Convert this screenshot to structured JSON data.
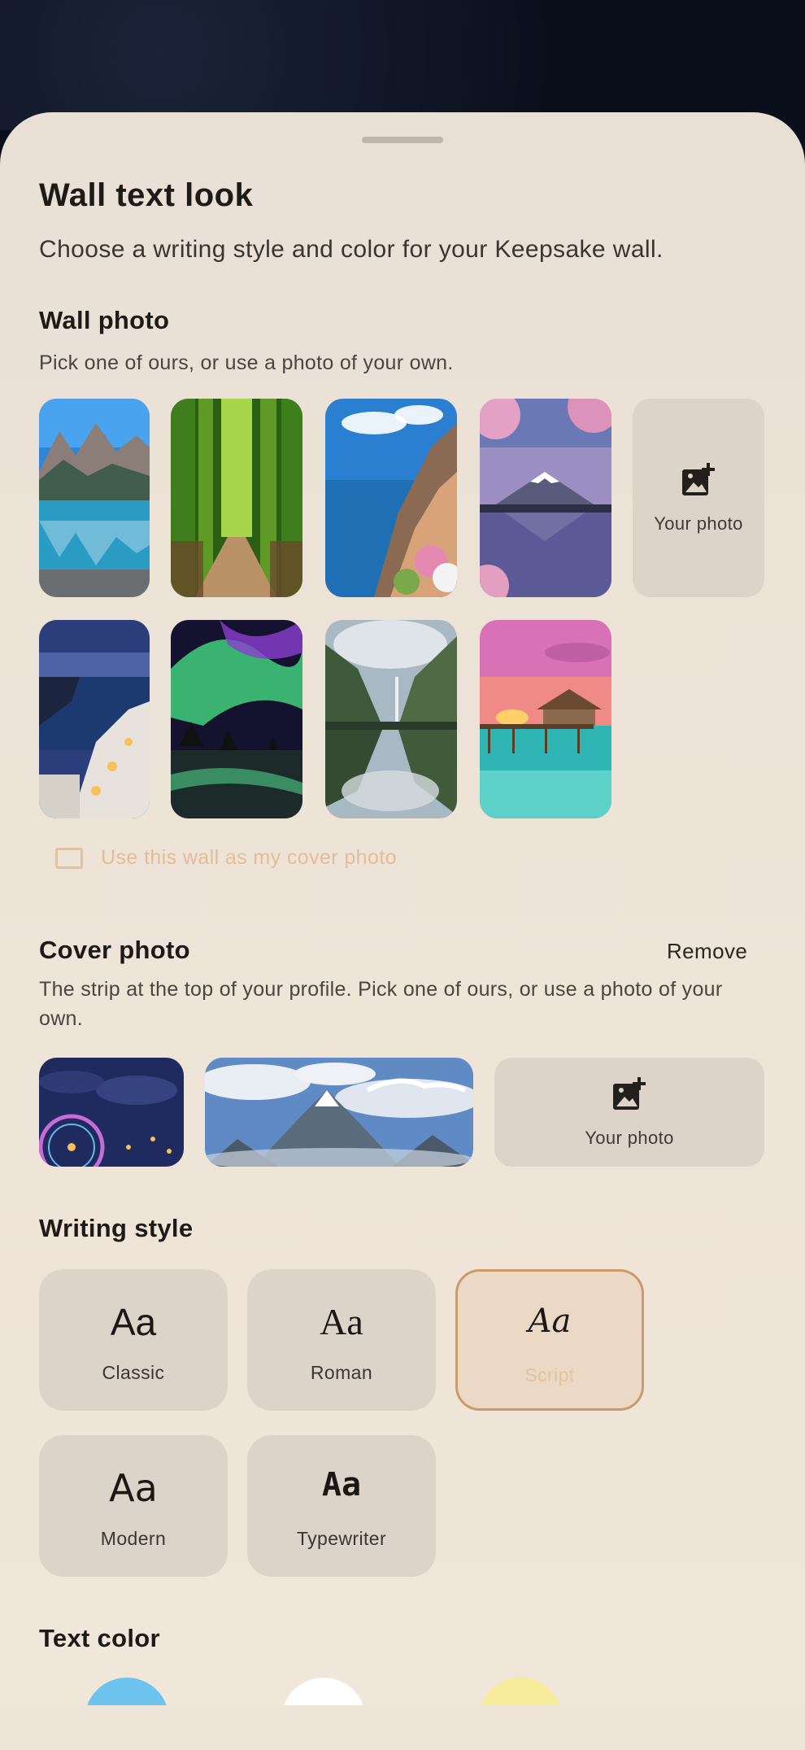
{
  "sheet": {
    "title": "Wall text look",
    "subtitle": "Choose a writing style and color for your Keepsake wall."
  },
  "wall_photo": {
    "title": "Wall photo",
    "description": "Pick one of ours, or use a photo of your own.",
    "thumbnails": [
      "lake-mountains",
      "bamboo-path",
      "coastal-village",
      "cherry-blossom-mountain",
      "cliff-town-night",
      "aurora-beach",
      "fjord-reflection",
      "overwater-bungalow"
    ],
    "your_photo_label": "Your photo",
    "your_photo_icon": "add-photo-icon",
    "cover_checkbox_label": "Use this wall as my cover photo"
  },
  "cover_photo": {
    "title": "Cover photo",
    "remove_label": "Remove",
    "description": "The strip at the top of your profile. Pick one of ours, or use a photo of your own.",
    "thumbnails": [
      "ferris-wheel-night",
      "dragon-mountain-sky"
    ],
    "your_photo_label": "Your photo",
    "your_photo_icon": "add-photo-icon"
  },
  "writing_style": {
    "title": "Writing style",
    "options": [
      {
        "sample": "Aa",
        "label": "Classic"
      },
      {
        "sample": "Aa",
        "label": "Roman"
      },
      {
        "sample": "Aa",
        "label": "Script"
      },
      {
        "sample": "Aa",
        "label": "Modern"
      },
      {
        "sample": "Aa",
        "label": "Typewriter"
      }
    ],
    "selected": "Script"
  },
  "text_color": {
    "title": "Text color",
    "swatches": [
      "#6cc4ee",
      "#ffffff",
      "#f7ec9c"
    ]
  },
  "colors": {
    "accent_border": "#c99a6b",
    "sheet_bg": "#ece2d6"
  }
}
